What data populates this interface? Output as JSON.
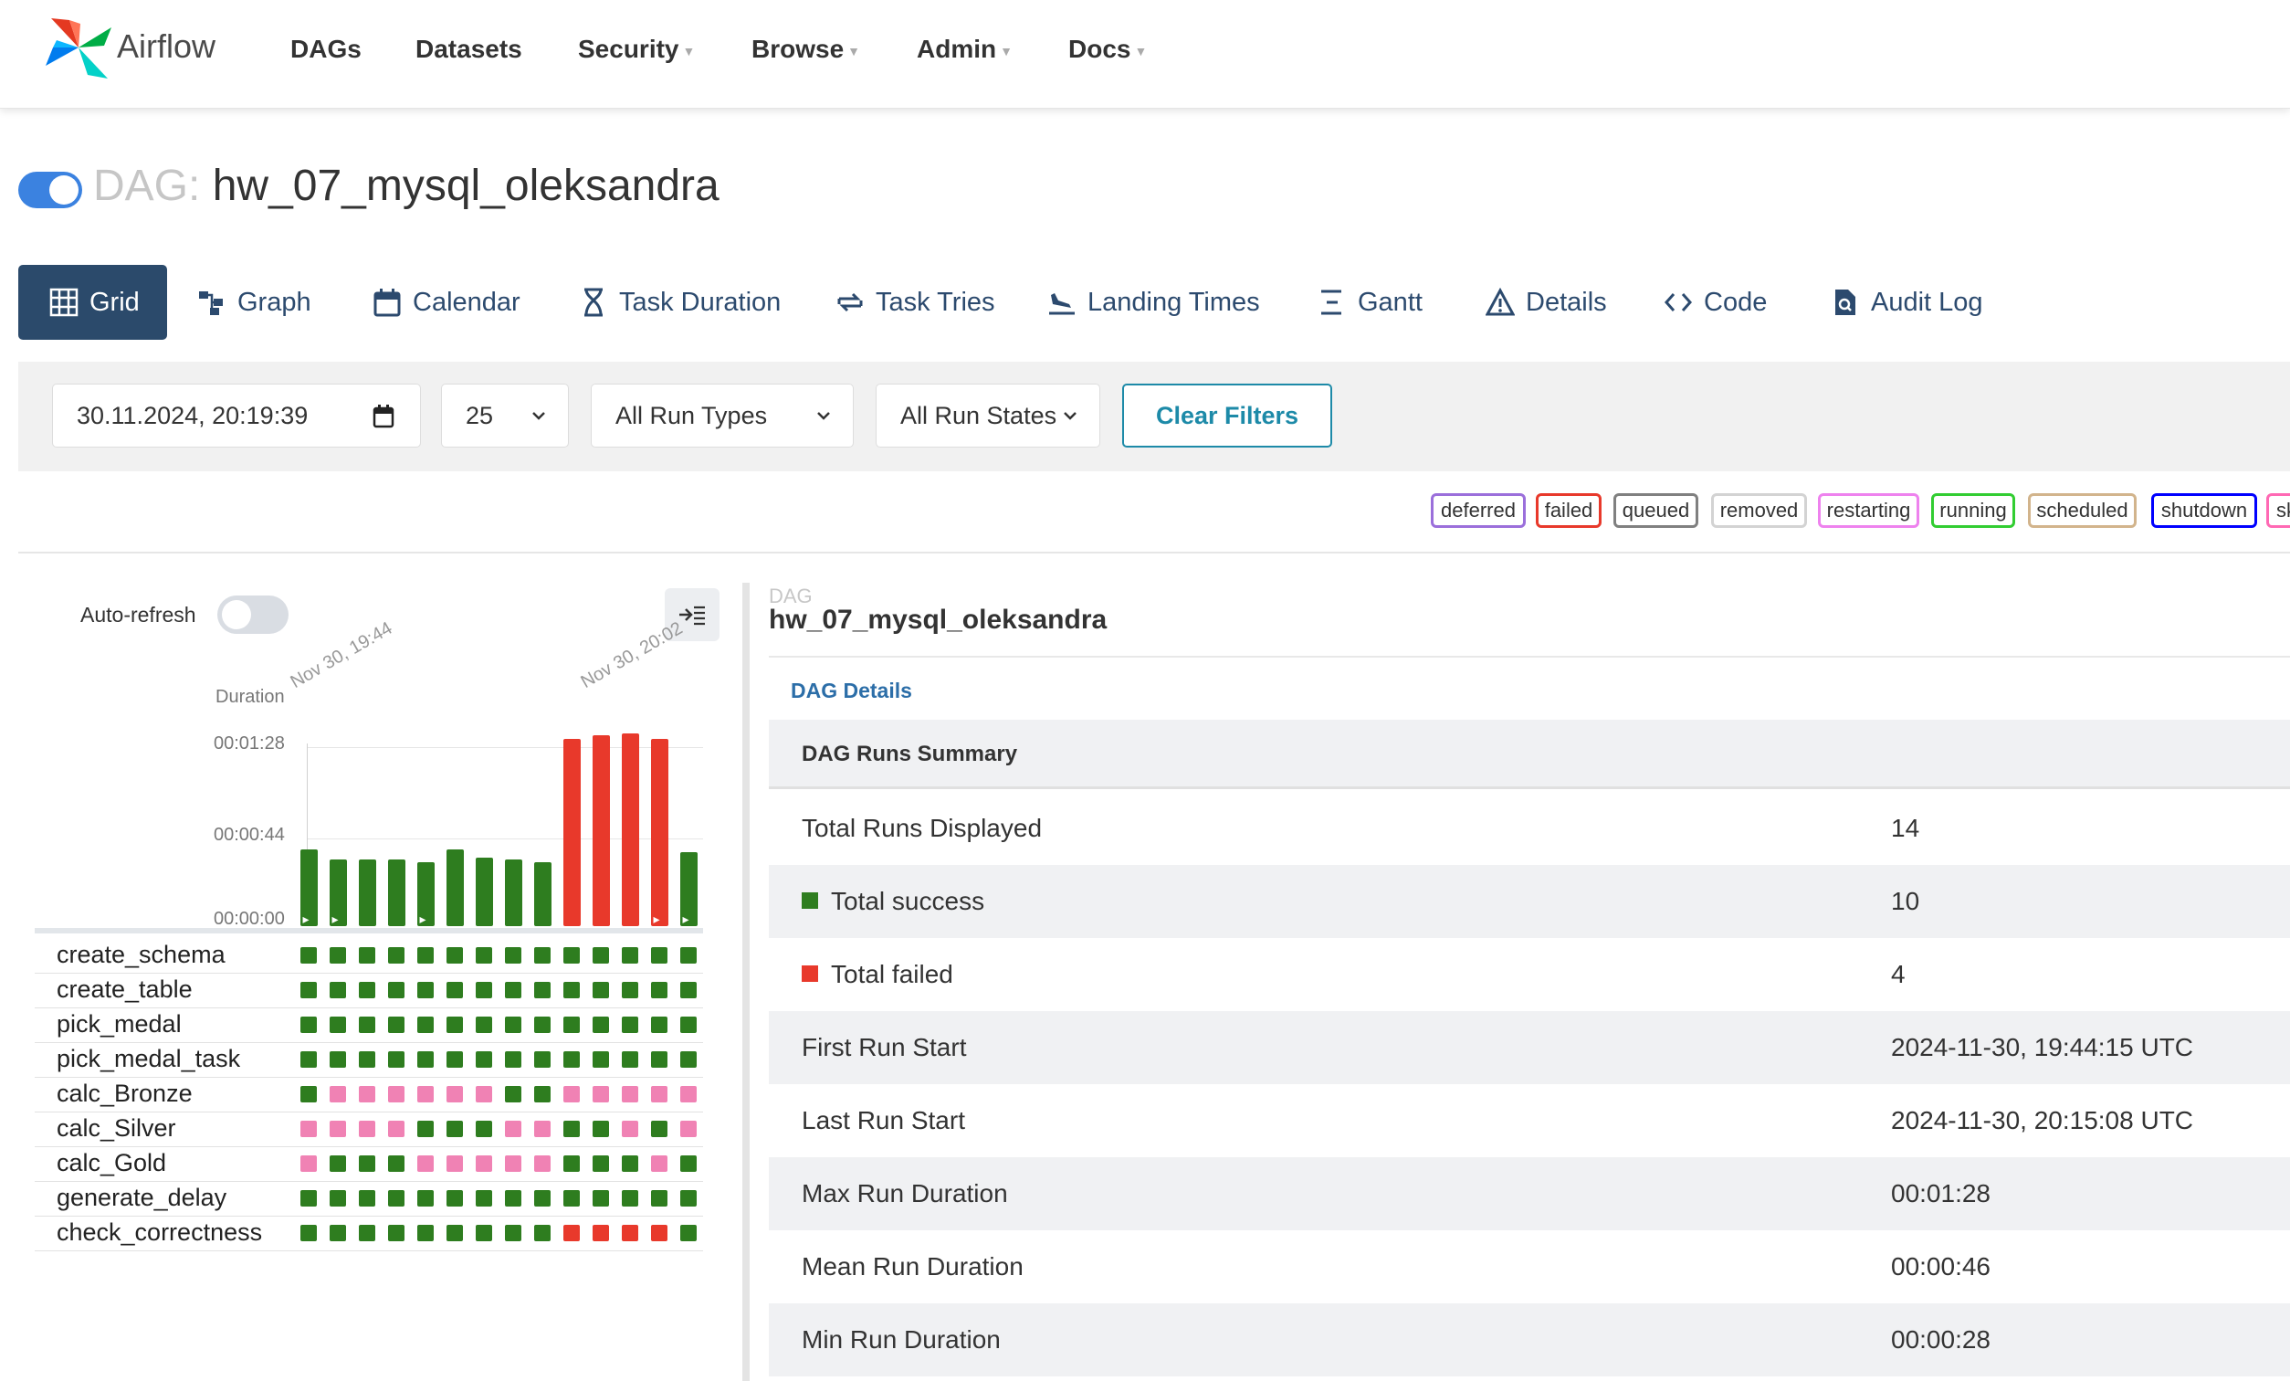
{
  "brand": {
    "name": "Airflow"
  },
  "nav": [
    {
      "label": "DAGs",
      "dropdown": false
    },
    {
      "label": "Datasets",
      "dropdown": false
    },
    {
      "label": "Security",
      "dropdown": true
    },
    {
      "label": "Browse",
      "dropdown": true
    },
    {
      "label": "Admin",
      "dropdown": true
    },
    {
      "label": "Docs",
      "dropdown": true
    }
  ],
  "dag": {
    "prefix": "DAG:",
    "name": "hw_07_mysql_oleksandra",
    "paused": false
  },
  "tabs": [
    {
      "label": "Grid",
      "icon": "grid-icon",
      "active": true
    },
    {
      "label": "Graph",
      "icon": "graph-icon"
    },
    {
      "label": "Calendar",
      "icon": "calendar-icon"
    },
    {
      "label": "Task Duration",
      "icon": "hourglass-icon"
    },
    {
      "label": "Task Tries",
      "icon": "retry-icon"
    },
    {
      "label": "Landing Times",
      "icon": "plane-landing-icon"
    },
    {
      "label": "Gantt",
      "icon": "gantt-icon"
    },
    {
      "label": "Details",
      "icon": "warning-triangle-icon"
    },
    {
      "label": "Code",
      "icon": "code-icon"
    },
    {
      "label": "Audit Log",
      "icon": "file-search-icon"
    }
  ],
  "filters": {
    "datetime": "30.11.2024, 20:19:39",
    "num_runs": "25",
    "run_type": "All Run Types",
    "run_state": "All Run States",
    "clear_label": "Clear Filters"
  },
  "legend": [
    {
      "label": "deferred",
      "color": "#9b6fdb"
    },
    {
      "label": "failed",
      "color": "#e8392b"
    },
    {
      "label": "queued",
      "color": "#808080"
    },
    {
      "label": "removed",
      "color": "#d3d3d3"
    },
    {
      "label": "restarting",
      "color": "#ee82ee"
    },
    {
      "label": "running",
      "color": "#32cd32"
    },
    {
      "label": "scheduled",
      "color": "#d2b48c"
    },
    {
      "label": "shutdown",
      "color": "#0000ff"
    },
    {
      "label": "sk",
      "color": "#ff69b4"
    }
  ],
  "grid": {
    "auto_refresh_label": "Auto-refresh",
    "auto_refresh_on": false,
    "duration_label": "Duration",
    "duration_ticks": [
      "00:01:28",
      "00:00:44",
      "00:00:00"
    ],
    "date_labels": [
      "Nov 30, 19:44",
      "Nov 30, 20:02"
    ],
    "colors": {
      "success": "#2e7d1f",
      "failed": "#e8392b",
      "upstream_failed": "#f082b4"
    },
    "runs": [
      {
        "duration": 38,
        "state": "success",
        "manual": true
      },
      {
        "duration": 33,
        "state": "success",
        "manual": true
      },
      {
        "duration": 33,
        "state": "success",
        "manual": false
      },
      {
        "duration": 33,
        "state": "success",
        "manual": false
      },
      {
        "duration": 32,
        "state": "success",
        "manual": true
      },
      {
        "duration": 38,
        "state": "success",
        "manual": false
      },
      {
        "duration": 34,
        "state": "success",
        "manual": false
      },
      {
        "duration": 33,
        "state": "success",
        "manual": false
      },
      {
        "duration": 32,
        "state": "success",
        "manual": false
      },
      {
        "duration": 93,
        "state": "failed",
        "manual": false
      },
      {
        "duration": 95,
        "state": "failed",
        "manual": false
      },
      {
        "duration": 96,
        "state": "failed",
        "manual": false
      },
      {
        "duration": 93,
        "state": "failed",
        "manual": true
      },
      {
        "duration": 37,
        "state": "success",
        "manual": true
      }
    ],
    "tasks": [
      {
        "name": "create_schema",
        "states": "SSSSSSSSSSSSSS"
      },
      {
        "name": "create_table",
        "states": "SSSSSSSSSSSSSS"
      },
      {
        "name": "pick_medal",
        "states": "SSSSSSSSSSSSSS"
      },
      {
        "name": "pick_medal_task",
        "states": "SSSSSSSSSSSSSS"
      },
      {
        "name": "calc_Bronze",
        "states": "SUUUUUUSSUUUUU"
      },
      {
        "name": "calc_Silver",
        "states": "UUUUSSSUUSSUSU"
      },
      {
        "name": "calc_Gold",
        "states": "USSSUUUUUSSSUS"
      },
      {
        "name": "generate_delay",
        "states": "SSSSSSSSSSSSSS"
      },
      {
        "name": "check_correctness",
        "states": "SSSSSSSSSFFFFS"
      }
    ]
  },
  "details": {
    "small_label": "DAG",
    "dag_name": "hw_07_mysql_oleksandra",
    "link_label": "DAG Details",
    "summary_title": "DAG Runs Summary",
    "rows": [
      {
        "key": "Total Runs Displayed",
        "value": "14"
      },
      {
        "key": "Total success",
        "value": "10",
        "swatch": "#2e7d1f"
      },
      {
        "key": "Total failed",
        "value": "4",
        "swatch": "#e8392b"
      },
      {
        "key": "First Run Start",
        "value": "2024-11-30, 19:44:15 UTC"
      },
      {
        "key": "Last Run Start",
        "value": "2024-11-30, 20:15:08 UTC"
      },
      {
        "key": "Max Run Duration",
        "value": "00:01:28"
      },
      {
        "key": "Mean Run Duration",
        "value": "00:00:46"
      },
      {
        "key": "Min Run Duration",
        "value": "00:00:28"
      }
    ]
  },
  "theme": {
    "toggle_on": "#3b82e0",
    "toggle_off": "#d9dde3",
    "tab_active": "#2b4a6b"
  }
}
